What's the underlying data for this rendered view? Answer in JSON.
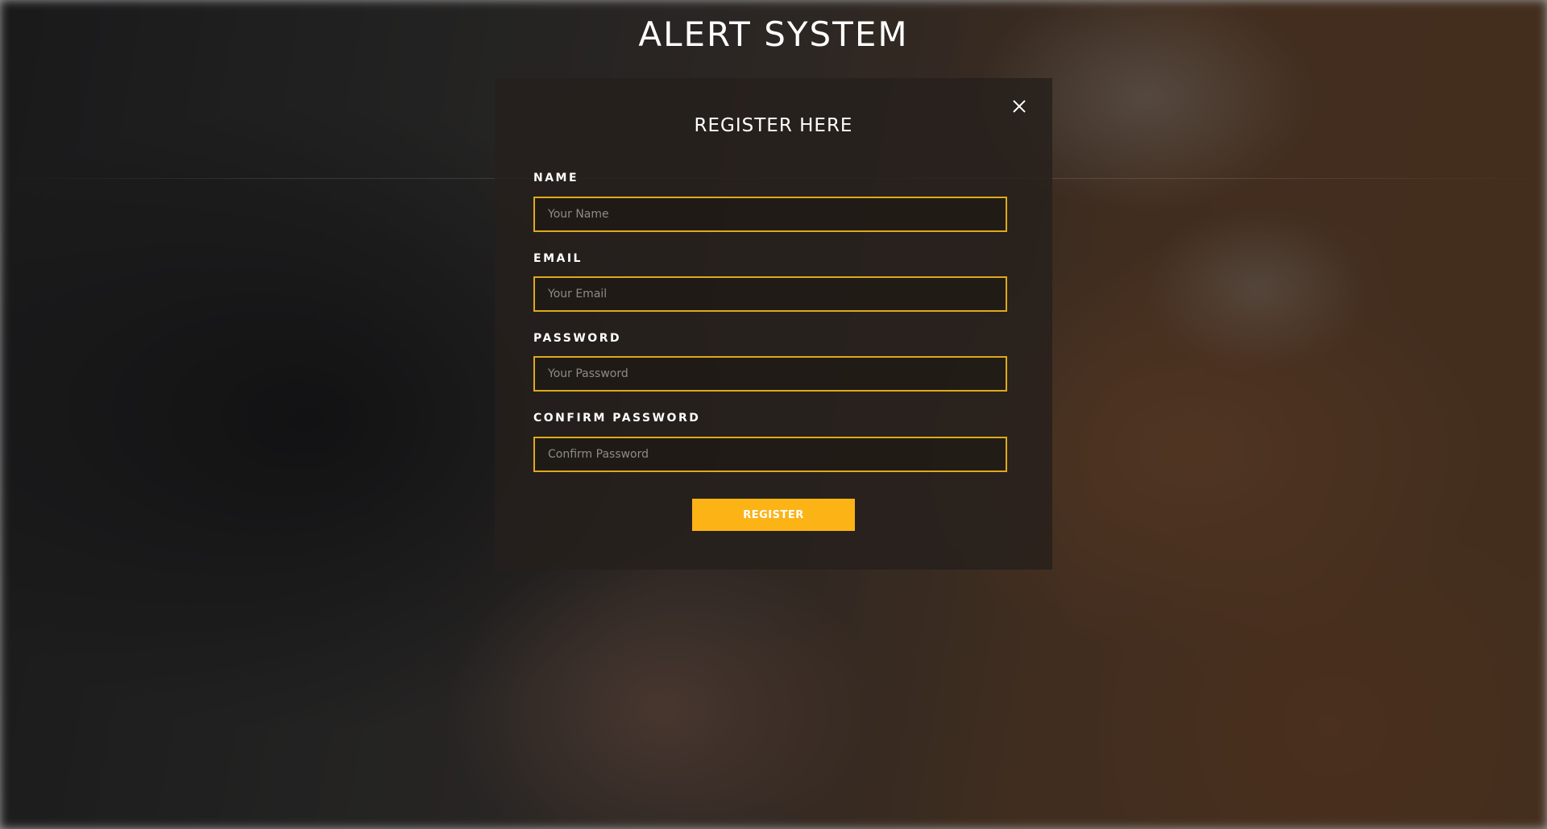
{
  "page": {
    "title": "ALERT SYSTEM"
  },
  "modal": {
    "title": "REGISTER HERE",
    "close_icon": "close-icon",
    "fields": [
      {
        "label": "NAME",
        "placeholder": "Your Name",
        "value": ""
      },
      {
        "label": "EMAIL",
        "placeholder": "Your Email",
        "value": ""
      },
      {
        "label": "PASSWORD",
        "placeholder": "Your Password",
        "value": ""
      },
      {
        "label": "CONFIRM PASSWORD",
        "placeholder": "Confirm Password",
        "value": ""
      }
    ],
    "submit_label": "REGISTER"
  },
  "colors": {
    "accent": "#fcb316",
    "input_border": "#e0a91a",
    "text": "#ffffff"
  }
}
